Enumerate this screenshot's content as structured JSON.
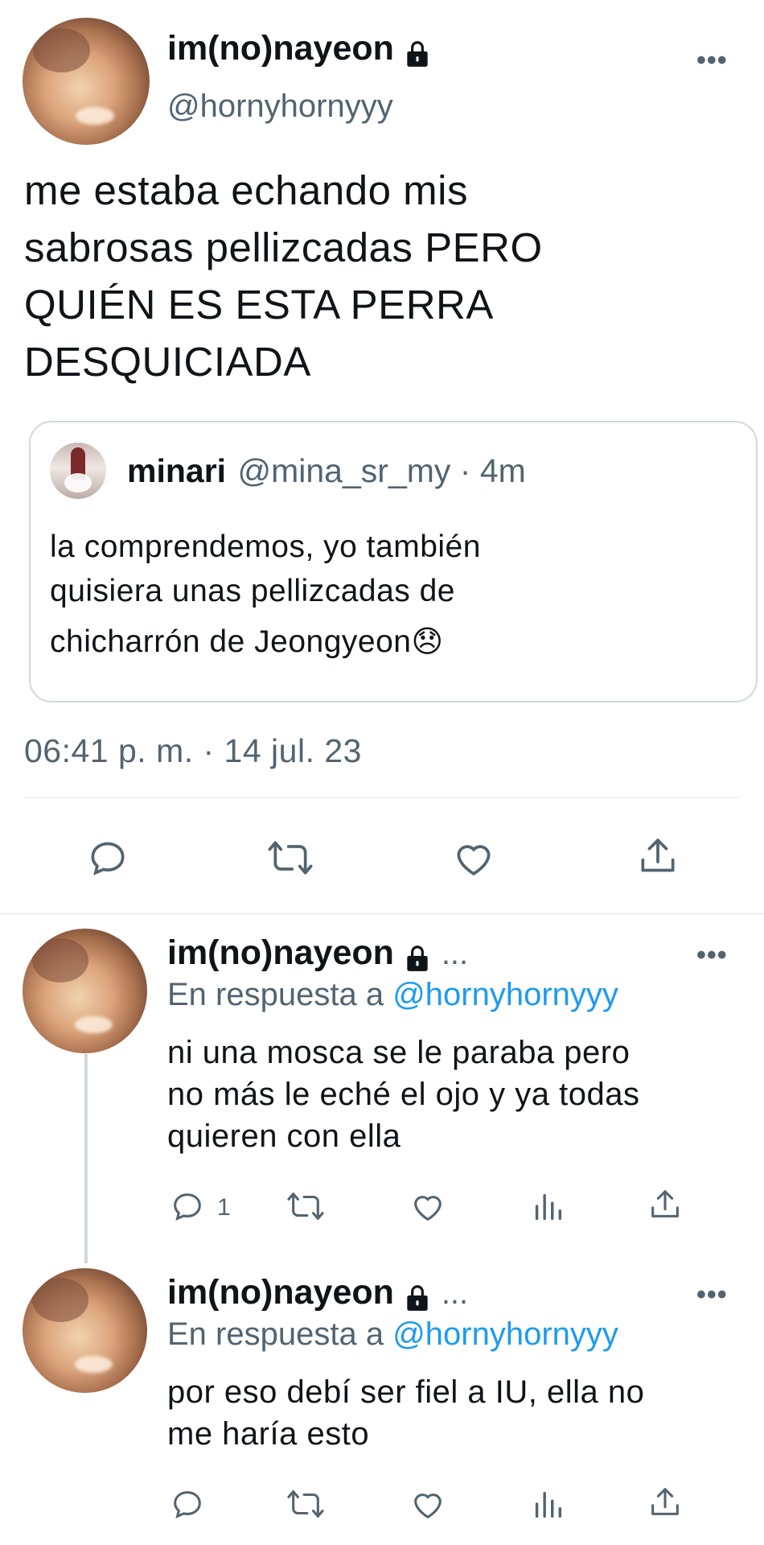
{
  "main_tweet": {
    "display_name": "im(no)nayeon",
    "handle": "@hornyhornyyy",
    "more": "•••",
    "text_lines": [
      "me estaba echando mis",
      "sabrosas pellizcadas PERO",
      "QUIÉN ES ESTA PERRA",
      "DESQUICIADA"
    ],
    "quote": {
      "display_name": "minari",
      "meta": "@mina_sr_my · 4m",
      "text_lines": [
        "la comprendemos, yo también",
        "quisiera unas pellizcadas de",
        "chicharrón de Jeongyeon"
      ],
      "emoji": "😞"
    },
    "timestamp": "06:41 p. m. · 14 jul. 23",
    "actions": [
      "reply-icon",
      "retweet-icon",
      "like-icon",
      "share-icon"
    ]
  },
  "replies": [
    {
      "display_name": "im(no)nayeon",
      "ellipsis": "...",
      "more": "•••",
      "reply_prefix": "En respuesta a",
      "reply_mention": "@hornyhornyyy",
      "text_lines": [
        "ni una mosca se le paraba pero",
        "no más le eché el ojo y ya todas",
        "quieren con ella"
      ],
      "reply_count": "1"
    },
    {
      "display_name": "im(no)nayeon",
      "ellipsis": "...",
      "more": "•••",
      "reply_prefix": "En respuesta a",
      "reply_mention": "@hornyhornyyy",
      "text_lines": [
        "por eso debí ser fiel a IU, ella no",
        "me haría esto"
      ],
      "reply_count": ""
    }
  ],
  "colors": {
    "text": "#0f1419",
    "secondary": "#536471",
    "link": "#1d9bf0",
    "border": "#cfd9de"
  }
}
